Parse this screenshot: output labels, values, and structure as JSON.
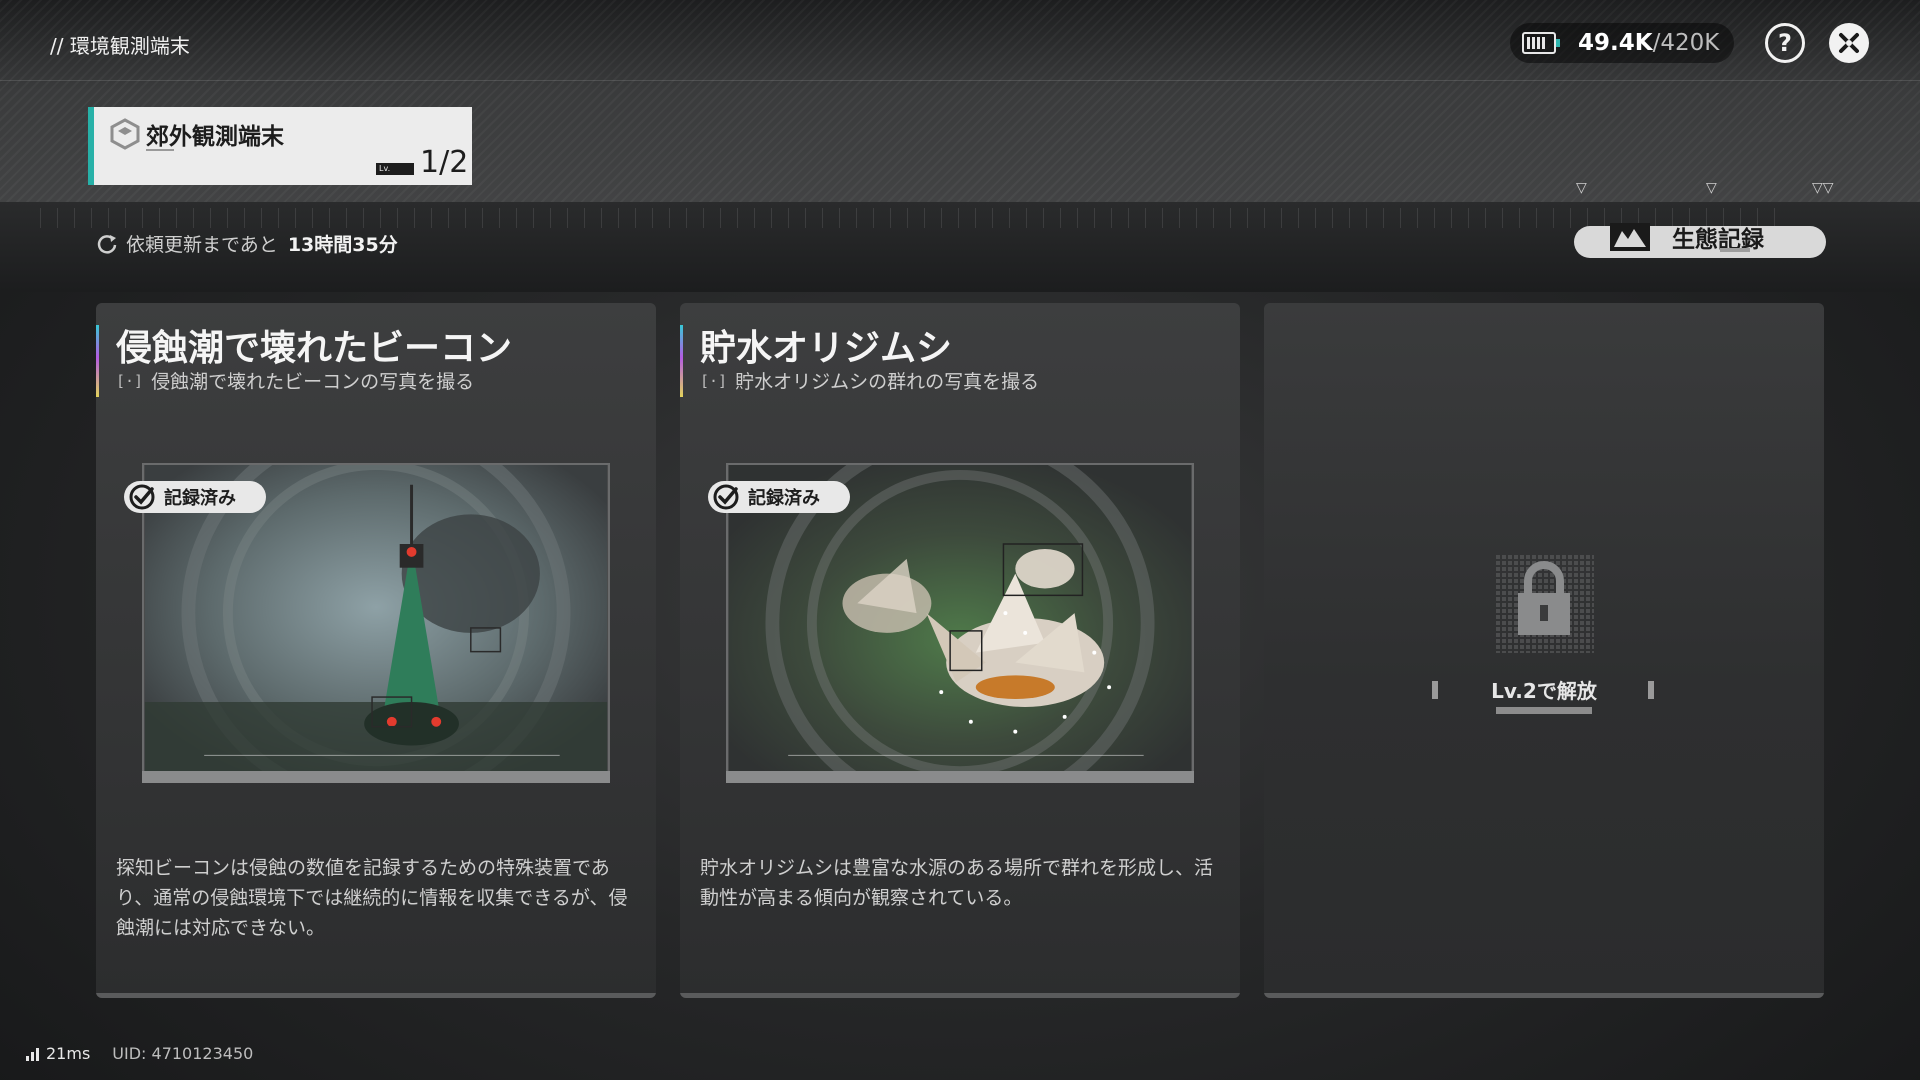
{
  "header": {
    "breadcrumb": "// 環境観測端末",
    "currency_value": "49.4K",
    "currency_max": "/420K",
    "icons": [
      "battery-icon",
      "help-icon",
      "close-icon"
    ]
  },
  "terminal": {
    "name": "郊外観測端末",
    "level_badge": "Lv.",
    "level": "1/2"
  },
  "refresh": {
    "label": "依頼更新まであと",
    "time": "13時間35分"
  },
  "eco_button": {
    "label": "生態記録"
  },
  "cards": [
    {
      "title": "侵蝕潮で壊れたビーコン",
      "subtitle": "侵蝕潮で壊れたビーコンの写真を撮る",
      "badge": "記録済み",
      "description": "探知ビーコンは侵蝕の数値を記録するための特殊装置であり、通常の侵蝕環境下では継続的に情報を収集できるが、侵蝕潮には対応できない。"
    },
    {
      "title": "貯水オリジムシ",
      "subtitle": "貯水オリジムシの群れの写真を撮る",
      "badge": "記録済み",
      "description": "貯水オリジムシは豊富な水源のある場所で群れを形成し、活動性が高まる傾向が観察されている。"
    },
    {
      "locked": true,
      "unlock_text": "Lv.2で解放"
    }
  ],
  "footer": {
    "ping": "21ms",
    "uid": "UID: 4710123450"
  },
  "colors": {
    "accent_teal": "#27b1a8",
    "card_bg": "#363738"
  }
}
